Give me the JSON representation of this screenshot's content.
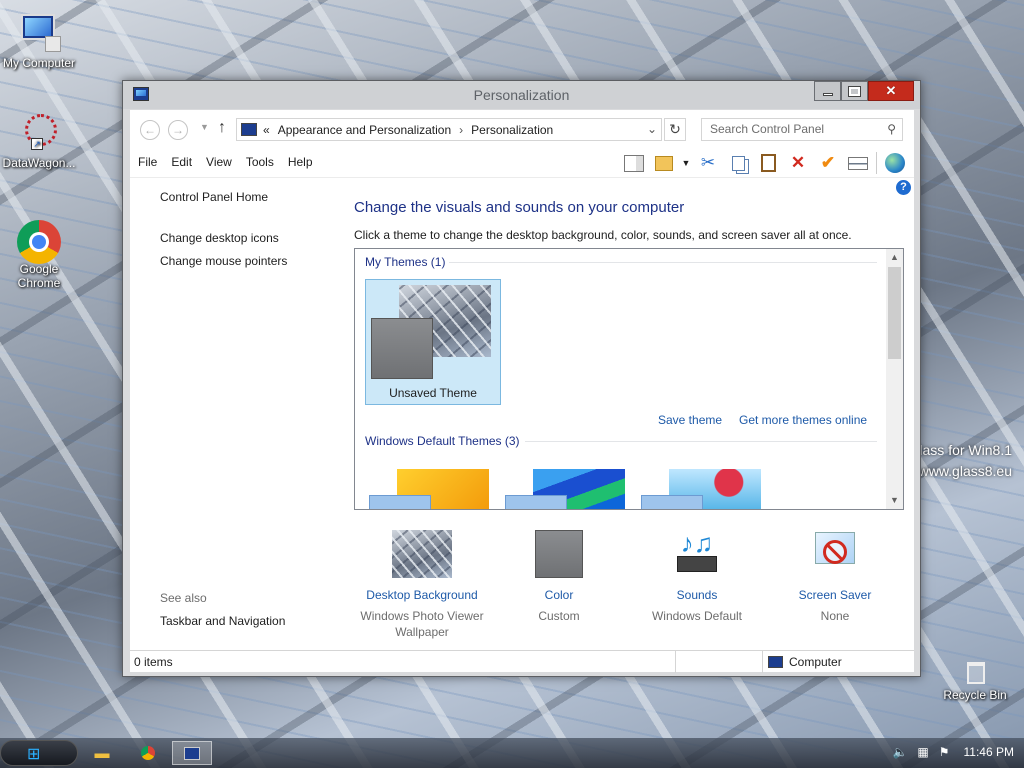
{
  "desktop": {
    "icons": [
      {
        "label": "My Computer",
        "icon": "computer-icon"
      },
      {
        "label": "DataWagon...",
        "icon": "datawagon-icon"
      },
      {
        "label": "Google Chrome",
        "icon": "chrome-icon"
      },
      {
        "label": "Recycle Bin",
        "icon": "recycle-bin-icon"
      }
    ],
    "overlay_line1": "lass for Win8.1",
    "overlay_line2": "www.glass8.eu"
  },
  "window": {
    "title": "Personalization",
    "controls": {
      "minimize": "minimize",
      "maximize": "maximize",
      "close": "✕"
    }
  },
  "address": {
    "prefix": "«",
    "crumbs": [
      "Appearance and Personalization",
      "Personalization"
    ],
    "search_placeholder": "Search Control Panel"
  },
  "menu": [
    "File",
    "Edit",
    "View",
    "Tools",
    "Help"
  ],
  "toolbar_icons": [
    "layout-icon",
    "folder-options-icon",
    "dropdown-icon",
    "cut-icon",
    "copy-icon",
    "paste-icon",
    "delete-icon",
    "checkmark-icon",
    "properties-icon",
    "globe-icon"
  ],
  "left_pane": {
    "home": "Control Panel Home",
    "links": [
      "Change desktop icons",
      "Change mouse pointers"
    ],
    "see_also": "See also",
    "see_also_links": [
      "Taskbar and Navigation"
    ]
  },
  "main": {
    "heading": "Change the visuals and sounds on your computer",
    "subtext": "Click a theme to change the desktop background, color, sounds, and screen saver all at once.",
    "my_themes_group": "My Themes (1)",
    "unsaved_theme": "Unsaved Theme",
    "save_theme": "Save theme",
    "get_more": "Get more themes online",
    "default_group": "Windows Default Themes (3)"
  },
  "settings": [
    {
      "label": "Desktop Background",
      "value": "Windows Photo Viewer Wallpaper",
      "icon": "wallpaper-icon"
    },
    {
      "label": "Color",
      "value": "Custom",
      "icon": "color-swatch-icon"
    },
    {
      "label": "Sounds",
      "value": "Windows Default",
      "icon": "music-notes-icon"
    },
    {
      "label": "Screen Saver",
      "value": "None",
      "icon": "no-screensaver-icon"
    }
  ],
  "status": {
    "items": "0 items",
    "location": "Computer"
  },
  "taskbar": {
    "clock": "11:46 PM"
  },
  "colors": {
    "link": "#1e5aa8",
    "heading": "#1e3287",
    "close_button": "#c42b1c",
    "selection": "#cce8f8"
  }
}
